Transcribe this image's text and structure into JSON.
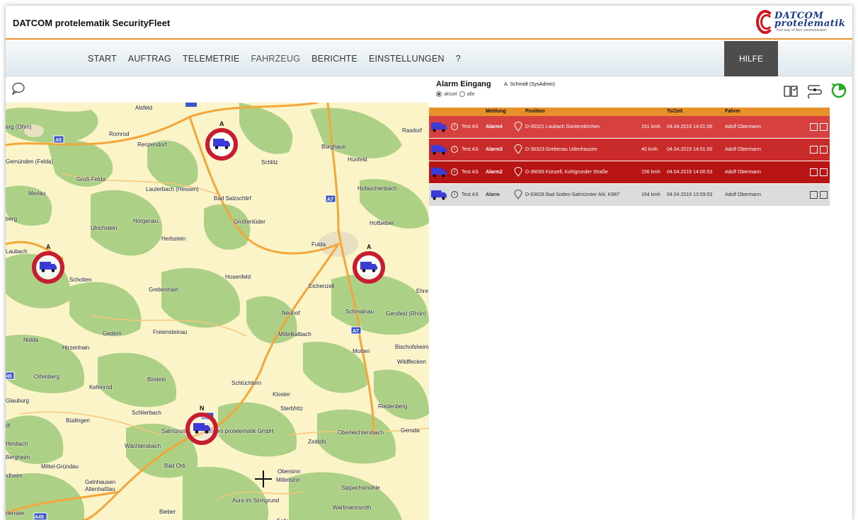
{
  "app": {
    "title": "DATCOM protelematik SecurityFleet"
  },
  "logo": {
    "line1": "DATCOM",
    "line2": "protelematik",
    "tagline": "Your way of fleet communication",
    "brand_red": "#d4141c",
    "brand_blue": "#1b3b8c"
  },
  "nav": {
    "items": [
      "START",
      "AUFTRAG",
      "TELEMETRIE",
      "FAHRZEUG",
      "BERICHTE",
      "EINSTELLUNGEN",
      "?"
    ],
    "active": "FAHRZEUG",
    "help_label": "HILFE"
  },
  "map": {
    "places": [
      {
        "name": "Alsfeld"
      },
      {
        "name": "erg (Ohm)"
      },
      {
        "name": "Romrod"
      },
      {
        "name": "Renzendorf"
      },
      {
        "name": "Rasdorf"
      },
      {
        "name": "Burghaun"
      },
      {
        "name": "Hünfeld"
      },
      {
        "name": "Schlitz"
      },
      {
        "name": "Gemünden (Felda)"
      },
      {
        "name": "Groß-Felda"
      },
      {
        "name": "Merlau"
      },
      {
        "name": "Lauterbach (Hessen)"
      },
      {
        "name": "Bad Salzschlirf"
      },
      {
        "name": "Hofaschenbach"
      },
      {
        "name": "berg"
      },
      {
        "name": "Ulrichstein"
      },
      {
        "name": "Hörgenau"
      },
      {
        "name": "Großenlüder"
      },
      {
        "name": "Hofbieber"
      },
      {
        "name": "Herbstein"
      },
      {
        "name": "Laubach"
      },
      {
        "name": "Fulda"
      },
      {
        "name": "Schotten"
      },
      {
        "name": "Hosenfeld"
      },
      {
        "name": "Grebenhain"
      },
      {
        "name": "Eichenzell"
      },
      {
        "name": "Ehre"
      },
      {
        "name": "Neuhof"
      },
      {
        "name": "Schmalnau"
      },
      {
        "name": "Gersfeld (Rhön)"
      },
      {
        "name": "Gedern"
      },
      {
        "name": "Freiensteinau"
      },
      {
        "name": "Mittelkalbach"
      },
      {
        "name": "Nidda"
      },
      {
        "name": "Bischofsheim"
      },
      {
        "name": "Hirzenhain"
      },
      {
        "name": "Motten"
      },
      {
        "name": "Wildflecken"
      },
      {
        "name": "Ortenberg"
      },
      {
        "name": "Kefenrod"
      },
      {
        "name": "Birstein"
      },
      {
        "name": "Schlüchtern"
      },
      {
        "name": "Kloster"
      },
      {
        "name": "Glauburg"
      },
      {
        "name": "Sterbfritz"
      },
      {
        "name": "Riedenberg"
      },
      {
        "name": "Schlierbach"
      },
      {
        "name": "Büdingen"
      },
      {
        "name": "Salmünster"
      },
      {
        "name": "Datcom protelematik GmbH"
      },
      {
        "name": "Oberleichtersbach"
      },
      {
        "name": "Geroda"
      },
      {
        "name": "Wächtersbach"
      },
      {
        "name": "Zeitlofs"
      },
      {
        "name": "Himbach"
      },
      {
        "name": "Bergheim"
      },
      {
        "name": "Mittel-Gründau"
      },
      {
        "name": "Bad Orb"
      },
      {
        "name": "Obersinn"
      },
      {
        "name": "Mittelsinn"
      },
      {
        "name": "Gelnhausen"
      },
      {
        "name": "Altenhaßlau"
      },
      {
        "name": "Sippachsmühle"
      },
      {
        "name": "Aura im Sinngrund"
      },
      {
        "name": "Wartmannsroth"
      },
      {
        "name": "Bieber"
      },
      {
        "name": "Fellen"
      },
      {
        "name": "rlensee"
      },
      {
        "name": "idheim"
      },
      {
        "name": "dt"
      }
    ],
    "road_shields": [
      "A5",
      "A7",
      "A7",
      "A66",
      "A45",
      "45"
    ],
    "markers": [
      {
        "letter": "A",
        "status": "alarm"
      },
      {
        "letter": "A",
        "status": "alarm"
      },
      {
        "letter": "A",
        "status": "alarm"
      },
      {
        "letter": "N",
        "status": "normal"
      }
    ],
    "colors": {
      "land": "#fbf4c8",
      "forest": "#a8cf82",
      "road": "#f3a63a",
      "marker_ring": "#c81d30",
      "truck": "#3b3bd8"
    }
  },
  "alarm": {
    "title": "Alarm Eingang",
    "user": "A. Schmidt (SysAdmin)",
    "filter": {
      "option_current": "aktuel",
      "option_all": "alle",
      "selected": "aktuel"
    },
    "columns": {
      "message": "Meldung",
      "position": "Position",
      "ts": "Ts/Zeit",
      "driver": "Fahrer"
    },
    "rows": [
      {
        "vehicle": "Test AS",
        "message": "Alarm4",
        "position": "D-35321 Laubach Gonterskirchen",
        "speed": "151 kmh",
        "timestamp": "04.04.2019 14:01:06",
        "driver": "Adolf Obermann",
        "color": "#d6413f"
      },
      {
        "vehicle": "Test AS",
        "message": "Alarm3",
        "position": "D-36323 Grebenau Udenhausen",
        "speed": "40 kmh",
        "timestamp": "04.04.2019 14:01:00",
        "driver": "Adolf Obermann",
        "color": "#c92a2a"
      },
      {
        "vehicle": "Test AS",
        "message": "Alarm2",
        "position": "D-36093 Künzell, Kohlgrunder Straße",
        "speed": "156 kmh",
        "timestamp": "04.04.2019 14:00:53",
        "driver": "Adolf Obermann",
        "color": "#b81414"
      },
      {
        "vehicle": "Test AS",
        "message": "Alarm",
        "position": "D-63628 Bad Soden-Salmünster Ahl, K987",
        "speed": "164 kmh",
        "timestamp": "04.04.2019 13:59:53",
        "driver": "Adolf Obermann",
        "color": "#dcdcdc"
      }
    ]
  },
  "colors": {
    "accent": "#e8902a",
    "nav_bg": "#e5eef3",
    "help_bg": "#4d4d4d"
  }
}
